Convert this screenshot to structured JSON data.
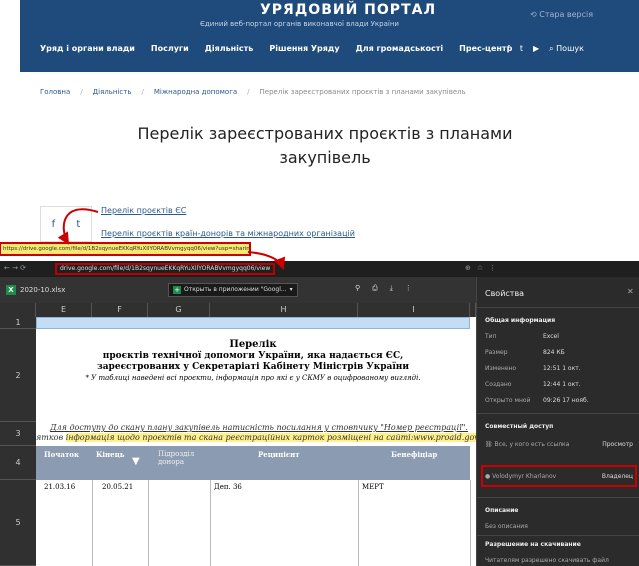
{
  "portal": {
    "title": "Урядовий портал",
    "subtitle": "Єдиний веб-портал органів виконавчої влади України",
    "old_version": "Стара версія",
    "nav": [
      "Уряд і органи влади",
      "Послуги",
      "Діяльність",
      "Рішення Уряду",
      "Для громадськості",
      "Прес-центр"
    ],
    "search": "Пошук"
  },
  "breadcrumbs": [
    "Головна",
    "Діяльність",
    "Міжнародна допомога",
    "Перелік зареєстрованих проєктів з планами закупівель"
  ],
  "page_title": "Перелік зареєстрованих проєктів з планами закупівель",
  "links": [
    "Перелік проєктів ЄС",
    "Перелік проєктів країн-донорів та міжнародних організацій"
  ],
  "url_tooltip": "https://drive.google.com/file/d/1B2sqynueEKKqRYuXIlYORABVvmgyqq06/view?usp=sharing",
  "address_bar": "drive.google.com/file/d/1B2sqynueEKKqRYuXIlYORABVvmgyqq06/view",
  "viewer": {
    "filename": "2020-10.xlsx",
    "open_button": "Открыть в приложении \"Googl...",
    "columns": [
      "E",
      "F",
      "G",
      "H",
      "I"
    ],
    "rows": [
      "1",
      "2",
      "3",
      "4",
      "5"
    ],
    "heading_1": "Перелік",
    "heading_2": "проєктів технічної допомоги України, яка надається ЄС,",
    "heading_3": "зареєстрованих у Секретаріаті Кабінету Міністрів України",
    "heading_note": "* У таблиці наведені всі проєкти, інформація про які є у СКМУ в оцифрованому вигляді.",
    "note_1": "Для доступу до скану плану закупівель натисність посилання у стовпчику \"Номер реєстрації\".",
    "note_2_prefix": "ятков",
    "note_2_highlight": "інформація щодо проєктів та скана реєстраційних карток розміщені на сайті:www.proaid.gov.ua",
    "headers": [
      "Початок",
      "Кінець",
      "Підрозділ донора",
      "Реципієнт",
      "Бенефіціар"
    ],
    "row5": [
      "21.03.16",
      "20.05.21",
      "",
      "Деп. 36",
      "МЕРТ"
    ]
  },
  "properties": {
    "title": "Свойства",
    "general_title": "Общая информация",
    "general": [
      {
        "k": "Тип",
        "v": "Excel"
      },
      {
        "k": "Размер",
        "v": "824 КБ"
      },
      {
        "k": "Изменено",
        "v": "12:51 1 окт."
      },
      {
        "k": "Создано",
        "v": "12:44 1 окт."
      },
      {
        "k": "Открыто мной",
        "v": "09:26 17 нояб."
      }
    ],
    "sharing_title": "Совместный доступ",
    "sharing": [
      {
        "who": "Все, у кого есть ссылка",
        "role": "Просмотр"
      },
      {
        "who": "Volodymyr Kharlanov",
        "role": "Владелец"
      }
    ],
    "description_title": "Описание",
    "description": "Без описания",
    "download_title": "Разрешение на скачивание",
    "download": "Читателям разрешено скачивать файл"
  }
}
